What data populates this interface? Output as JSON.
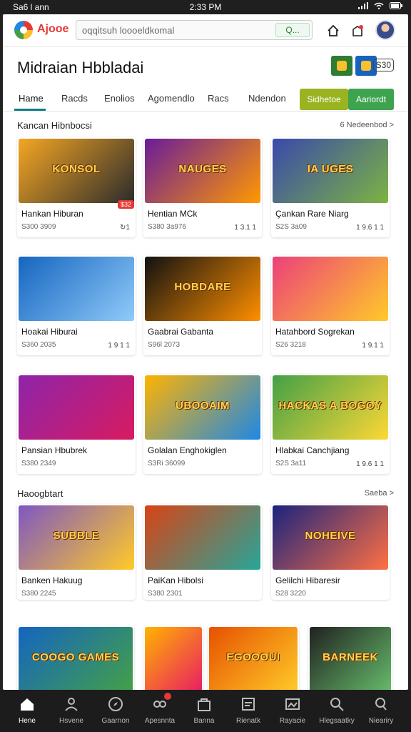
{
  "status": {
    "carrier": "Sa6 l ann",
    "time": "2:33 PM"
  },
  "app": {
    "logo_text": "Ajooe"
  },
  "search": {
    "value": "oqqitsuh loooeldkomal",
    "button": "Q..."
  },
  "page_title": "Midraian Hbbladai",
  "title_tag": "S30",
  "tabs": [
    {
      "label": "Hame"
    },
    {
      "label": "Racds"
    },
    {
      "label": "Enolios"
    },
    {
      "label": "Agomendlo"
    },
    {
      "label": "Racs"
    },
    {
      "label": "Ndendon"
    }
  ],
  "pills": {
    "one": "Sidhetoe",
    "two": "Aariordt"
  },
  "section1": {
    "title": "Kancan Hibnbocsi",
    "link": "6 Nedeenbod >"
  },
  "section2": {
    "title": "Haoogbtart",
    "link": "Saeba >"
  },
  "cards_row1": [
    {
      "title": "Hankan Hiburan",
      "price": "S300 3909",
      "rating": "↻1",
      "badge": "$32",
      "art": "KONSOL",
      "c1": "#f5a623",
      "c2": "#2c2c2c"
    },
    {
      "title": "Hentian MCk",
      "price": "S380 3a976",
      "rating": "1 3.1 1",
      "art": "NAUGES",
      "c1": "#6a1b9a",
      "c2": "#ff9800"
    },
    {
      "title": "Çankan Rare Niarg",
      "price": "S2S 3a09",
      "rating": "1 9.6 1 1",
      "art": "IA UGES",
      "c1": "#3949ab",
      "c2": "#7cb342"
    }
  ],
  "cards_row2": [
    {
      "title": "Hoakai Hiburai",
      "price": "S360 2035",
      "rating": "1 9 1 1",
      "art": "",
      "c1": "#1565c0",
      "c2": "#90caf9"
    },
    {
      "title": "Gaabrai Gabanta",
      "price": "S96l 2073",
      "rating": "",
      "art": "HOBDARE",
      "c1": "#111111",
      "c2": "#ff8f00"
    },
    {
      "title": "Hatahbord Sogrekan",
      "price": "S26 3218",
      "rating": "1 9.1 1",
      "art": "",
      "c1": "#ec407a",
      "c2": "#ffca28"
    }
  ],
  "cards_row3": [
    {
      "title": "Pansian Hbubrek",
      "price": "S380 2349",
      "rating": "",
      "art": "",
      "c1": "#8e24aa",
      "c2": "#d81b60"
    },
    {
      "title": "Golalan Enghokiglen",
      "price": "S3Ri 36099",
      "rating": "",
      "art": "UBOOAIM",
      "c1": "#ffb300",
      "c2": "#1e88e5"
    },
    {
      "title": "Hlabkai Canchjiang",
      "price": "S2S 3a11",
      "rating": "1 9.6 1 1",
      "art": "HACKAS A BOGOY",
      "c1": "#43a047",
      "c2": "#fdd835"
    }
  ],
  "cards_row4": [
    {
      "title": "Banken Hakuug",
      "price": "S380 2245",
      "art": "SUBBLE",
      "c1": "#7e57c2",
      "c2": "#ffca28"
    },
    {
      "title": "PaiKan Hibolsi",
      "price": "S380 2301",
      "art": "",
      "c1": "#d84315",
      "c2": "#26a69a"
    },
    {
      "title": "Gelilchi Hibaresir",
      "price": "S28 3220",
      "art": "NOHEIVE",
      "c1": "#1a237e",
      "c2": "#ff7043"
    }
  ],
  "cards_row5": [
    {
      "art": "COOGO GAMES",
      "c1": "#1565c0",
      "c2": "#43a047"
    },
    {
      "art": "",
      "c1": "#ffb300",
      "c2": "#e91e63"
    },
    {
      "art": "EGOOOUI",
      "c1": "#e65100",
      "c2": "#ffca28"
    },
    {
      "art": "BARNEEK",
      "c1": "#212121",
      "c2": "#66bb6a"
    }
  ],
  "bottom_nav": [
    {
      "label": "Hene",
      "icon": "home-icon"
    },
    {
      "label": "Hsvene",
      "icon": "person-icon"
    },
    {
      "label": "Gaarnon",
      "icon": "compass-icon"
    },
    {
      "label": "Apesnnta",
      "icon": "games-icon"
    },
    {
      "label": "Banna",
      "icon": "bag-icon"
    },
    {
      "label": "Rienatk",
      "icon": "list-icon"
    },
    {
      "label": "Rayacie",
      "icon": "image-icon"
    },
    {
      "label": "Hlegsaatky",
      "icon": "search-icon"
    },
    {
      "label": "Nieariry",
      "icon": "magnify-icon"
    }
  ]
}
